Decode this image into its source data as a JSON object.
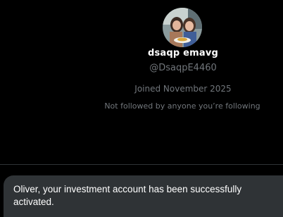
{
  "profile": {
    "avatar_icon": "profile-photo",
    "display_name": "dsaqp emavg",
    "handle": "@DsaqpE4460",
    "joined": "Joined November 2025",
    "followers_note": "Not followed by anyone you’re following"
  },
  "toast": {
    "message": "Oliver, your investment account has been successfully activated."
  },
  "colors": {
    "background": "#000000",
    "primary_text": "#ffffff",
    "secondary_text": "#71767b",
    "toast_background": "#2f3336"
  }
}
